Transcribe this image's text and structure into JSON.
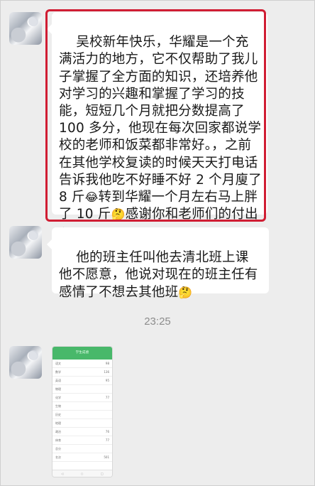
{
  "messages": [
    {
      "text": "吴校新年快乐，华耀是一个充满活力的地方，它不仅帮助了我儿子掌握了全方面的知识，还培养他对学习的兴趣和掌握了学习的技能，短短几个月就把分数提高了 100 多分，他现在每次回家都说学校的老师和饭菜都非常好。，之前在其他学校复读的时候天天打电话告诉我他吃不好睡不好 2 个月廋了 8 斤",
      "emoji1": "😂",
      "text2": "转到华耀一个月左右马上胖了 10 斤",
      "emoji2": "🤔",
      "text3": "感谢你和老师们的付出",
      "emoji3": "☕"
    },
    {
      "text": "他的班主任叫他去清北班上课他不愿意，他说对现在的班主任有感情了不想去其他班",
      "emoji": "🤔"
    }
  ],
  "timestamp": "23:25",
  "highlight_color": "#d01d33",
  "bubble_color": "#ffffff",
  "background_color": "#ededed",
  "screenshot_header": "学生成绩",
  "screenshot_rows": [
    {
      "label": "语文",
      "value": "98"
    },
    {
      "label": "数学",
      "value": "136"
    },
    {
      "label": "英语",
      "value": "95"
    },
    {
      "label": "物理",
      "value": ""
    },
    {
      "label": "化学",
      "value": "77"
    },
    {
      "label": "生物",
      "value": ""
    },
    {
      "label": "历史",
      "value": ""
    },
    {
      "label": "地理",
      "value": ""
    },
    {
      "label": "政治",
      "value": "76"
    },
    {
      "label": "体育",
      "value": "77"
    },
    {
      "label": "总分",
      "value": ""
    },
    {
      "label": "名次",
      "value": "501"
    }
  ],
  "screenshot_footer": [
    "◁",
    "○",
    "□"
  ]
}
